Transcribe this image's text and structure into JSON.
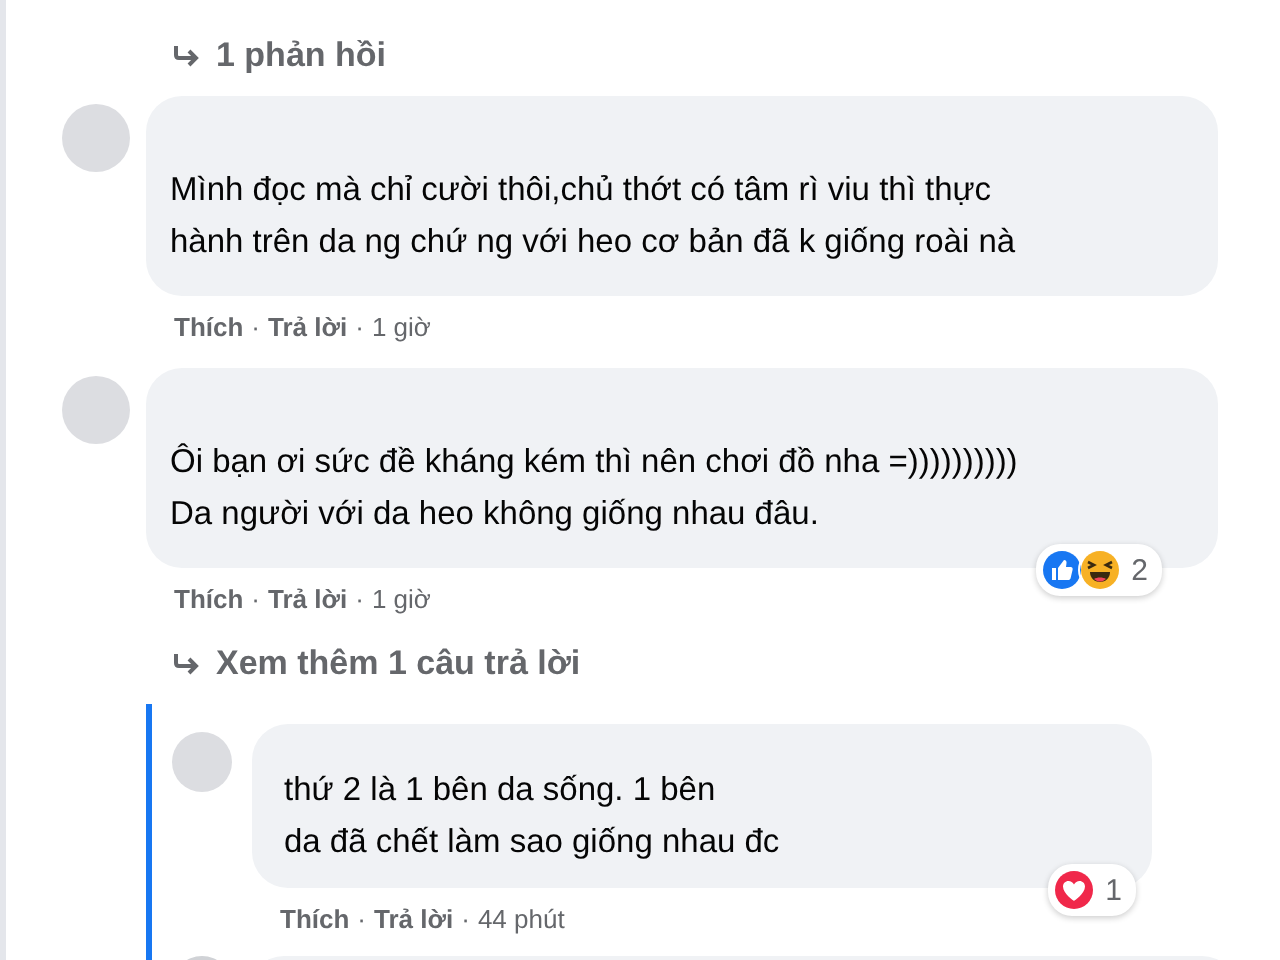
{
  "replies_link": {
    "text": "1 phản hồi"
  },
  "comments": [
    {
      "kind": "comment",
      "lines": [
        "Mình đọc mà chỉ cười thôi,chủ thớt có tâm rì viu thì thực",
        "hành trên da ng chứ ng với heo cơ bản đã k giống roài nà"
      ],
      "actions": [
        {
          "kind": "link",
          "text": "Thích"
        },
        {
          "kind": "sep",
          "text": "·"
        },
        {
          "kind": "link",
          "text": "Trả lời"
        },
        {
          "kind": "sep",
          "text": "·"
        },
        {
          "kind": "time",
          "text": "1 giờ"
        }
      ]
    },
    {
      "kind": "comment",
      "lines": [
        "Ôi bạn ơi sức đề kháng kém thì nên chơi đồ nha =))))))))))",
        "Da người với da heo không giống nhau đâu."
      ],
      "reactions": [
        {
          "kind": "like"
        },
        {
          "kind": "haha"
        }
      ],
      "reaction_count": "2",
      "actions": [
        {
          "kind": "link",
          "text": "Thích"
        },
        {
          "kind": "sep",
          "text": "·"
        },
        {
          "kind": "link",
          "text": "Trả lời"
        },
        {
          "kind": "sep",
          "text": "·"
        },
        {
          "kind": "time",
          "text": "1 giờ"
        }
      ],
      "more_replies": {
        "text": "Xem thêm 1 câu trả lời"
      },
      "replies": [
        {
          "kind": "comment",
          "lines": [
            "thứ 2 là 1 bên da sống. 1 bên",
            "da đã chết làm sao giống nhau đc"
          ],
          "reactions": [
            {
              "kind": "love"
            }
          ],
          "reaction_count": "1",
          "actions": [
            {
              "kind": "link",
              "text": "Thích"
            },
            {
              "kind": "sep",
              "text": "·"
            },
            {
              "kind": "link",
              "text": "Trả lời"
            },
            {
              "kind": "sep",
              "text": "·"
            },
            {
              "kind": "time",
              "text": "44 phút"
            }
          ]
        },
        {
          "kind": "partial"
        }
      ]
    }
  ]
}
